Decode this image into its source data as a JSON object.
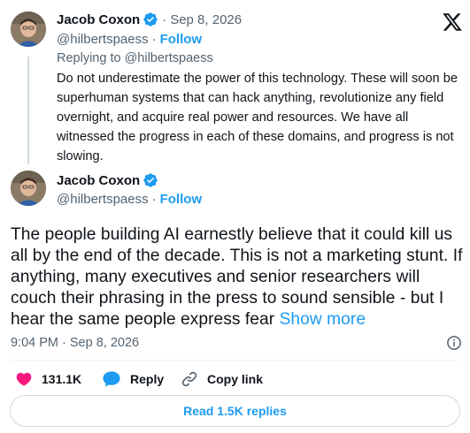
{
  "reply_tweet": {
    "author_name": "Jacob Coxon",
    "date": "Sep 8, 2026",
    "handle": "@hilbertspaess",
    "follow_label": "Follow",
    "replying_to": "Replying to @hilbertspaess",
    "text": "Do not underestimate the power of this technology. These will soon be superhuman systems that can hack anything, revolutionize any field overnight, and acquire real power and resources. We have all witnessed the progress in each of these domains, and progress is not slowing."
  },
  "main_tweet": {
    "author_name": "Jacob Coxon",
    "handle": "@hilbertspaess",
    "follow_label": "Follow",
    "text": "The people building AI earnestly believe that it could kill us all by the end of the decade. This is not a marketing stunt. If anything, many executives and senior researchers will couch their phrasing in the press to sound sensible - but I hear the same people express fear",
    "show_more_label": "Show more",
    "timestamp": "9:04 PM · Sep 8, 2026"
  },
  "actions": {
    "like_count": "131.1K",
    "reply_label": "Reply",
    "copy_link_label": "Copy link"
  },
  "read_replies_label": "Read 1.5K replies",
  "colors": {
    "accent": "#1d9bf0",
    "like": "#f91880",
    "muted": "#536471"
  },
  "icons": [
    "x-logo-icon",
    "verified-badge-icon",
    "info-icon",
    "heart-icon",
    "reply-bubble-icon",
    "link-icon"
  ]
}
